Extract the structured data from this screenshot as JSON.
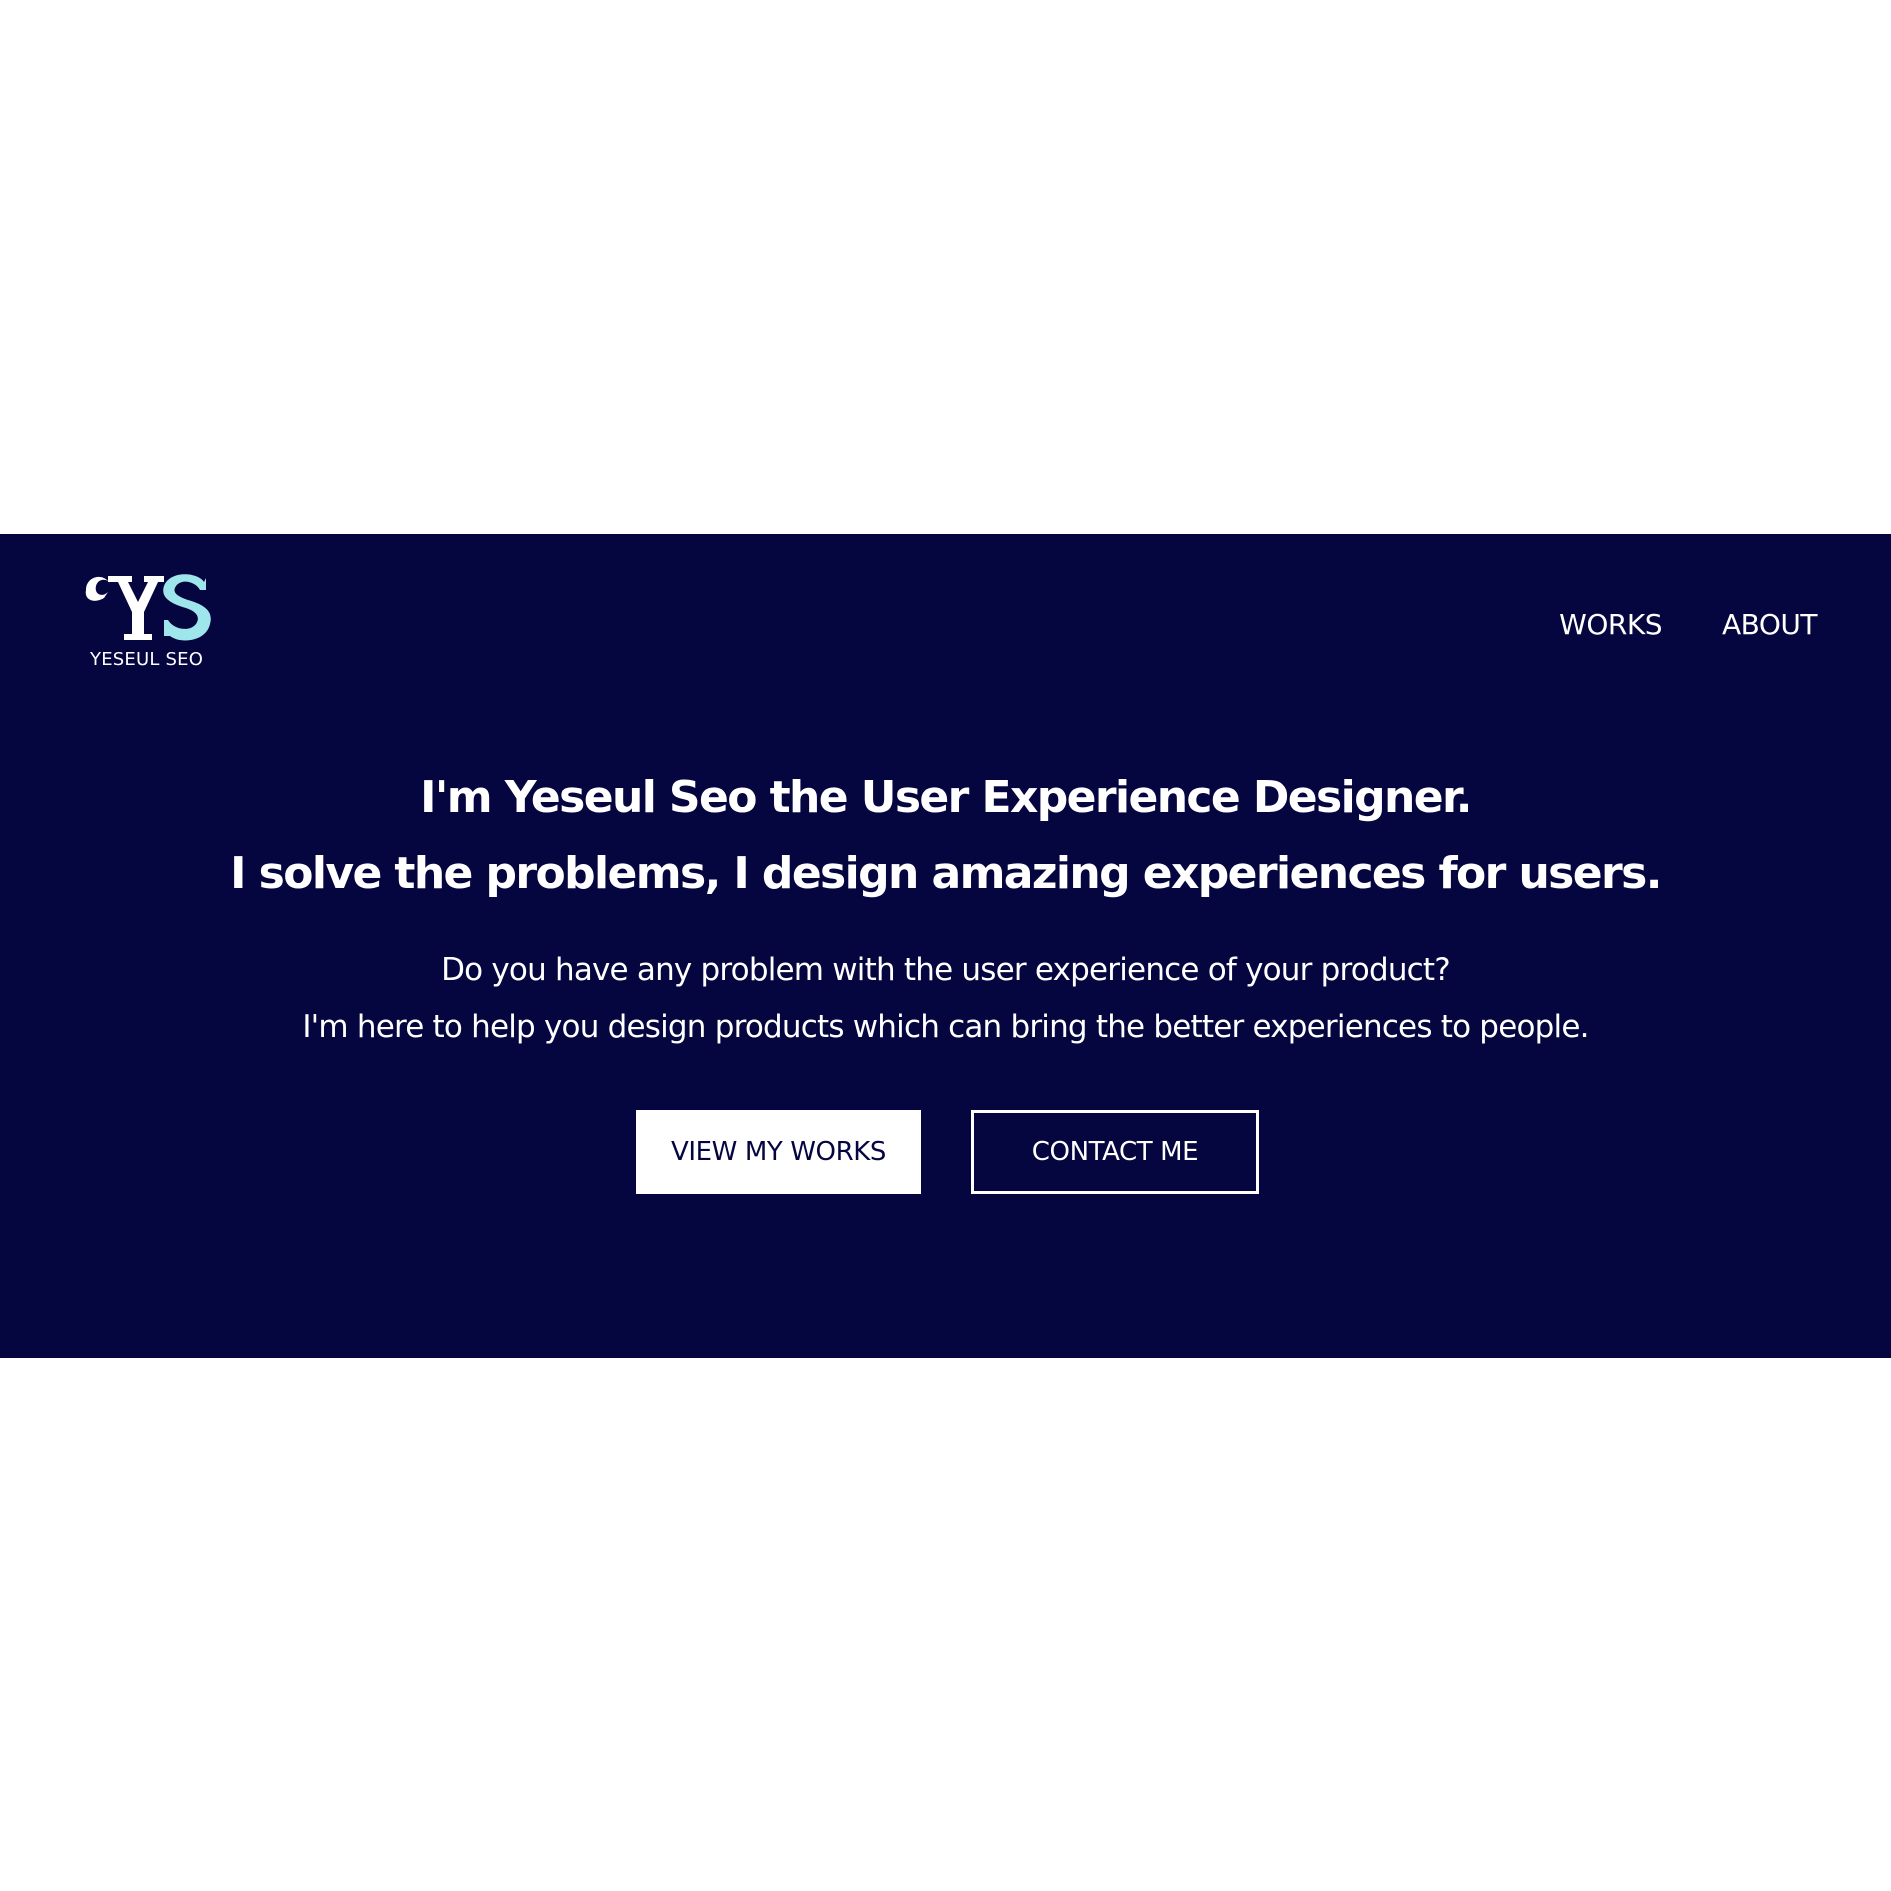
{
  "brand": {
    "logo_text": "YESEUL SEO",
    "logo_icon": "ys-monogram-icon",
    "colors": {
      "hero_background": "#050540",
      "logo_primary": "#ffffff",
      "logo_accent": "#9ee6eb"
    }
  },
  "nav": {
    "items": [
      {
        "label": "WORKS"
      },
      {
        "label": "ABOUT"
      }
    ]
  },
  "hero": {
    "headline_line1": "I'm Yeseul Seo the User Experience Designer.",
    "headline_line2": "I solve the problems, I design amazing experiences for users.",
    "subtext_line1": "Do you have any problem with the user experience of your product?",
    "subtext_line2": "I'm here to help you design products which can bring the better experiences to people.",
    "primary_button": "VIEW MY WORKS",
    "secondary_button": "CONTACT ME"
  }
}
